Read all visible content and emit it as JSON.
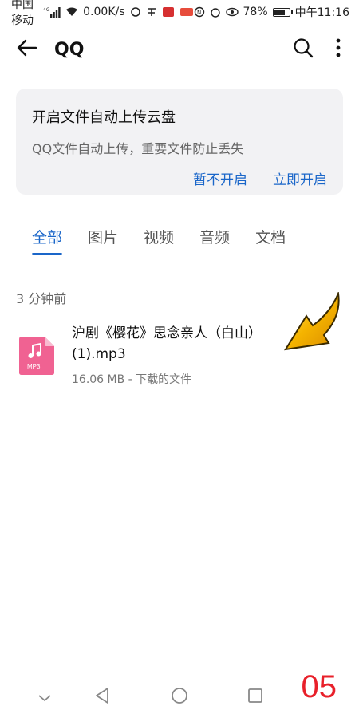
{
  "status_bar": {
    "carrier": "中国移动",
    "network": "4G",
    "speed": "0.00K/s",
    "battery": "78%",
    "battery_level": 0.78,
    "time": "中午11:16"
  },
  "header": {
    "title": "QQ"
  },
  "banner": {
    "title": "开启文件自动上传云盘",
    "subtitle": "QQ文件自动上传，重要文件防止丢失",
    "later_label": "暂不开启",
    "enable_label": "立即开启"
  },
  "tabs": [
    {
      "label": "全部",
      "active": true
    },
    {
      "label": "图片",
      "active": false
    },
    {
      "label": "视频",
      "active": false
    },
    {
      "label": "音频",
      "active": false
    },
    {
      "label": "文档",
      "active": false
    }
  ],
  "section": {
    "label": "3 分钟前"
  },
  "files": [
    {
      "name": "沪剧《樱花》思念亲人（白山）(1).mp3",
      "meta": "16.06 MB - 下载的文件",
      "icon_label": "MP3",
      "icon": "music-file-icon"
    }
  ],
  "overlay": {
    "page_number": "05"
  },
  "colors": {
    "accent": "#1a66c9",
    "file_icon": "#f06292",
    "page_number": "#e8202a"
  }
}
